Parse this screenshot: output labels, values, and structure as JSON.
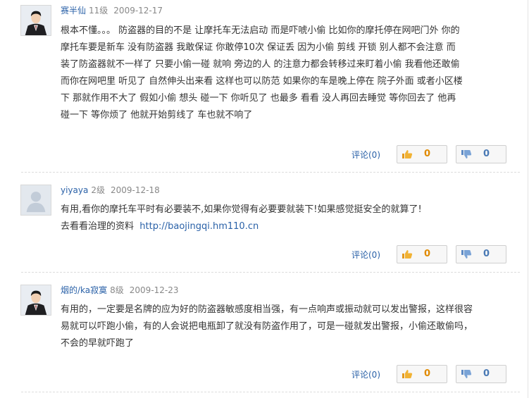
{
  "posts": [
    {
      "user": "赛半仙",
      "level": "11级",
      "date": "2009-12-17",
      "avatar": "avatar-man-suit",
      "lines": [
        "根本不懂。。。  防盗器的目的不是 让摩托车无法启动 而是吓唬小偷 比如你的摩托停在网吧门外 你的",
        "摩托车要是新车 没有防盗器 我敢保证 你敢停10次 保证丢 因为小偷 剪线 开锁 别人都不会注意  而",
        "装了防盗器就不一样了 只要小偷一碰 就响 旁边的人 的注意力都会转移过来盯着小偷 我看他还敢偷",
        "而你在网吧里 听见了 自然伸头出来看   这样也可以防范 如果你的车是晚上停在 院子外面 或者小区楼",
        "下 那就作用不大了 假如小偷 想头 碰一下 你听见了 也最多 看看 没人再回去睡觉 等你回去了 他再",
        "碰一下 等你烦了 他就开始剪线了 车也就不响了"
      ],
      "comment_label": "评论(0)",
      "up_count": "0",
      "down_count": "0"
    },
    {
      "user": "yiyaya",
      "level": "2级",
      "date": "2009-12-18",
      "avatar": "avatar-default-person",
      "lines": [
        "有用,看你的摩托车平时有必要装不,如果你觉得有必要要就装下!如果感觉挺安全的就算了!"
      ],
      "link_prefix": "去看看治理的资料",
      "link_text": "http://baojingqi.hm110.cn",
      "comment_label": "评论(0)",
      "up_count": "0",
      "down_count": "0"
    },
    {
      "user": "烟的/ka寂寞",
      "level": "8级",
      "date": "2009-12-23",
      "avatar": "avatar-man-suit",
      "lines": [
        "有用的，一定要是名牌的应为好的防盗器敏感度相当强，有一点响声或振动就可以发出警报，这样很容",
        "易就可以吓跑小偷，有的人会说把电瓶卸了就没有防盗作用了，可是一碰就发出警报，小偷还敢偷吗，",
        "不会的早就吓跑了"
      ],
      "comment_label": "评论(0)",
      "up_count": "0",
      "down_count": "0"
    }
  ],
  "colors": {
    "link": "#2b62a8",
    "up_count": "#e08a00",
    "down_count": "#4a7ab5"
  },
  "icons": {
    "up": "thumbs-up-icon",
    "down": "thumbs-down-icon"
  }
}
